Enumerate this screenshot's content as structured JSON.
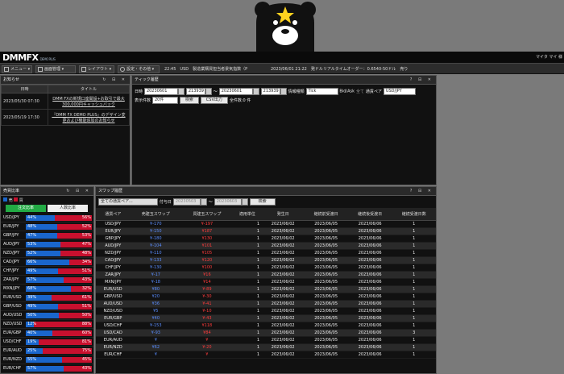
{
  "header": {
    "logo_main": "DMM",
    "logo_fx": "FX",
    "logo_sub": "DEMO PLUS",
    "user": "マイタ マイ 様"
  },
  "menu": {
    "items": [
      "メニュー",
      "画面管理",
      "レイアウト",
      "設定・その他"
    ],
    "tickers": [
      "22:45　USD　製造業購買担当者景気指数（P",
      "2023/06/01 21:22　発ドルリアルタイムオーダー：0.6540-50ドル　売り"
    ]
  },
  "news": {
    "title": "お知らせ",
    "columns": [
      "日時",
      "タイトル"
    ],
    "rows": [
      {
        "date": "2023/05/30 07:30",
        "text": "DMM FXの新規口座開設+お取引で最大300,000円キャッシュバック"
      },
      {
        "date": "2023/05/19 17:30",
        "text": "『DMM FX DEMO PLUS』のデザイン変更および機能追加のお知らせ"
      }
    ]
  },
  "tick": {
    "title": "ティック履歴",
    "date_label": "日時",
    "from_date": "20230601",
    "from_time": "213939",
    "tilde": "〜",
    "to_date": "20230601",
    "to_time": "213939",
    "info_label": "情報種類",
    "info_value": "Tick",
    "bidask_label": "Bid/Ask",
    "bidask_value": "全て",
    "pair_label": "通貨ペア",
    "pair_value": "USD/JPY",
    "count_label": "表示件数",
    "count_value": "20件",
    "search": "検索",
    "csv": "CSV出力",
    "total": "全件数:0 件"
  },
  "ratio": {
    "title": "売買比率",
    "legend_buy": "売",
    "legend_sell": "買",
    "tab_orders": "注文比率",
    "tab_people": "人数比率",
    "rows": [
      {
        "pair": "USD/JPY",
        "buy": 44,
        "sell": 56
      },
      {
        "pair": "EUR/JPY",
        "buy": 48,
        "sell": 52
      },
      {
        "pair": "GBP/JPY",
        "buy": 47,
        "sell": 53
      },
      {
        "pair": "AUD/JPY",
        "buy": 53,
        "sell": 47
      },
      {
        "pair": "NZD/JPY",
        "buy": 52,
        "sell": 48
      },
      {
        "pair": "CAD/JPY",
        "buy": 66,
        "sell": 34
      },
      {
        "pair": "CHF/JPY",
        "buy": 49,
        "sell": 51
      },
      {
        "pair": "ZAR/JPY",
        "buy": 57,
        "sell": 43
      },
      {
        "pair": "MXN/JPY",
        "buy": 68,
        "sell": 32
      },
      {
        "pair": "EUR/USD",
        "buy": 39,
        "sell": 61
      },
      {
        "pair": "GBP/USD",
        "buy": 49,
        "sell": 51
      },
      {
        "pair": "AUD/USD",
        "buy": 50,
        "sell": 50
      },
      {
        "pair": "NZD/USD",
        "buy": 12,
        "sell": 88
      },
      {
        "pair": "EUR/GBP",
        "buy": 40,
        "sell": 60
      },
      {
        "pair": "USD/CHF",
        "buy": 19,
        "sell": 81
      },
      {
        "pair": "EUR/AUD",
        "buy": 25,
        "sell": 75
      },
      {
        "pair": "EUR/NZD",
        "buy": 55,
        "sell": 45
      },
      {
        "pair": "EUR/CHF",
        "buy": 57,
        "sell": 43
      }
    ]
  },
  "swap": {
    "title": "スワップ履歴",
    "pair_select": "全ての通貨ペア...",
    "date_label": "付与日",
    "from": "20230503",
    "tilde": "〜",
    "to": "20230603",
    "search": "検索",
    "columns": [
      "通貨ペア",
      "売建玉スワップ",
      "買建玉スワップ",
      "適用単位",
      "発生日",
      "継続前受渡日",
      "継続後受渡日",
      "継続受渡日数"
    ],
    "rows": [
      {
        "pair": "USD/JPY",
        "sell": "¥-170",
        "buy": "¥-197",
        "unit": "1",
        "date": "2023/06/02",
        "pre": "2023/06/05",
        "post": "2023/06/06",
        "days": "1"
      },
      {
        "pair": "EUR/JPY",
        "sell": "¥-150",
        "buy": "¥187",
        "unit": "1",
        "date": "2023/06/02",
        "pre": "2023/06/05",
        "post": "2023/06/06",
        "days": "1"
      },
      {
        "pair": "GBP/JPY",
        "sell": "¥-180",
        "buy": "¥130",
        "unit": "1",
        "date": "2023/06/02",
        "pre": "2023/06/05",
        "post": "2023/06/06",
        "days": "1"
      },
      {
        "pair": "AUD/JPY",
        "sell": "¥-104",
        "buy": "¥101",
        "unit": "1",
        "date": "2023/06/02",
        "pre": "2023/06/05",
        "post": "2023/06/06",
        "days": "1"
      },
      {
        "pair": "NZD/JPY",
        "sell": "¥-110",
        "buy": "¥105",
        "unit": "1",
        "date": "2023/06/02",
        "pre": "2023/06/05",
        "post": "2023/06/06",
        "days": "1"
      },
      {
        "pair": "CAD/JPY",
        "sell": "¥-133",
        "buy": "¥120",
        "unit": "1",
        "date": "2023/06/02",
        "pre": "2023/06/05",
        "post": "2023/06/06",
        "days": "1"
      },
      {
        "pair": "CHF/JPY",
        "sell": "¥-130",
        "buy": "¥100",
        "unit": "1",
        "date": "2023/06/02",
        "pre": "2023/06/05",
        "post": "2023/06/06",
        "days": "1"
      },
      {
        "pair": "ZAR/JPY",
        "sell": "¥-17",
        "buy": "¥16",
        "unit": "1",
        "date": "2023/06/02",
        "pre": "2023/06/05",
        "post": "2023/06/06",
        "days": "1"
      },
      {
        "pair": "MXN/JPY",
        "sell": "¥-18",
        "buy": "¥14",
        "unit": "1",
        "date": "2023/06/02",
        "pre": "2023/06/05",
        "post": "2023/06/06",
        "days": "1"
      },
      {
        "pair": "EUR/USD",
        "sell": "¥80",
        "buy": "¥-89",
        "unit": "1",
        "date": "2023/06/02",
        "pre": "2023/06/05",
        "post": "2023/06/06",
        "days": "1"
      },
      {
        "pair": "GBP/USD",
        "sell": "¥20",
        "buy": "¥-30",
        "unit": "1",
        "date": "2023/06/02",
        "pre": "2023/06/05",
        "post": "2023/06/06",
        "days": "1"
      },
      {
        "pair": "AUD/USD",
        "sell": "¥36",
        "buy": "¥-41",
        "unit": "1",
        "date": "2023/06/02",
        "pre": "2023/06/05",
        "post": "2023/06/06",
        "days": "1"
      },
      {
        "pair": "NZD/USD",
        "sell": "¥5",
        "buy": "¥-10",
        "unit": "1",
        "date": "2023/06/02",
        "pre": "2023/06/05",
        "post": "2023/06/06",
        "days": "1"
      },
      {
        "pair": "EUR/GBP",
        "sell": "¥40",
        "buy": "¥-43",
        "unit": "1",
        "date": "2023/06/02",
        "pre": "2023/06/05",
        "post": "2023/06/06",
        "days": "1"
      },
      {
        "pair": "USD/CHF",
        "sell": "¥-153",
        "buy": "¥118",
        "unit": "1",
        "date": "2023/06/02",
        "pre": "2023/06/05",
        "post": "2023/06/06",
        "days": "1"
      },
      {
        "pair": "USD/CAD",
        "sell": "¥-93",
        "buy": "¥84",
        "unit": "1",
        "date": "2023/06/02",
        "pre": "2023/06/05",
        "post": "2023/06/06",
        "days": "3"
      },
      {
        "pair": "EUR/AUD",
        "sell": "¥",
        "buy": "¥",
        "unit": "1",
        "date": "2023/06/02",
        "pre": "2023/06/05",
        "post": "2023/06/06",
        "days": "1"
      },
      {
        "pair": "EUR/NZD",
        "sell": "¥62",
        "buy": "¥-20",
        "unit": "1",
        "date": "2023/06/02",
        "pre": "2023/06/05",
        "post": "2023/06/06",
        "days": "1"
      },
      {
        "pair": "EUR/CHF",
        "sell": "¥",
        "buy": "¥",
        "unit": "1",
        "date": "2023/06/02",
        "pre": "2023/06/05",
        "post": "2023/06/06",
        "days": "1"
      }
    ]
  },
  "colors": {
    "buy": "#1a66cc",
    "sell": "#c8102e",
    "accent_green": "#22aa44"
  }
}
